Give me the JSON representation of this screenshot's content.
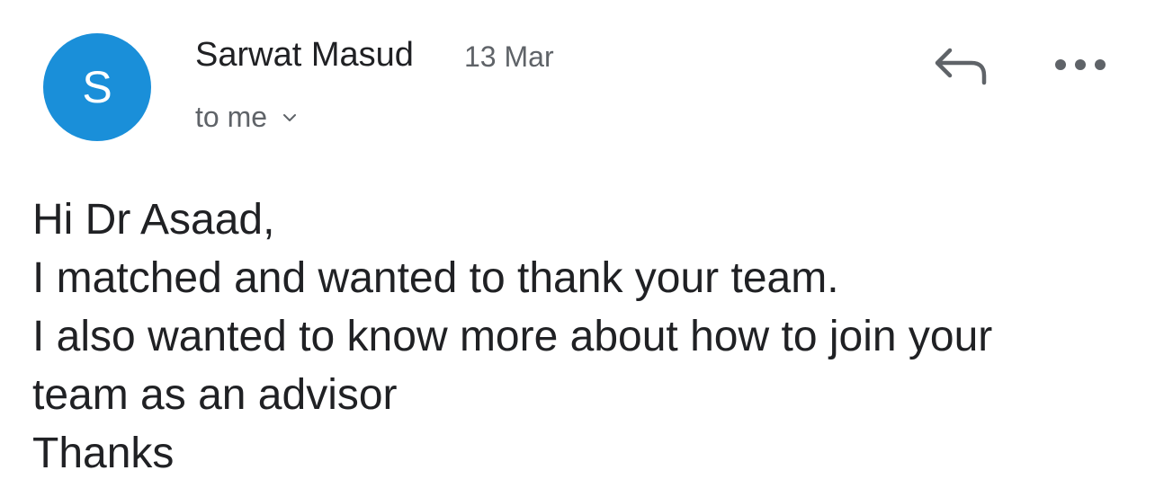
{
  "sender": {
    "initial": "S",
    "name": "Sarwat Masud",
    "date": "13 Mar",
    "recipient": "to me",
    "avatar_color": "#1a8fd9"
  },
  "actions": {
    "reply_icon": "reply-arrow-icon",
    "more_icon": "more-horizontal-dots-icon",
    "expand_icon": "chevron-down-icon"
  },
  "message": {
    "lines": [
      "Hi Dr Asaad,",
      "I matched and wanted to thank your team.",
      "I also wanted to know more about how to join your",
      "team as an advisor",
      "Thanks"
    ]
  }
}
